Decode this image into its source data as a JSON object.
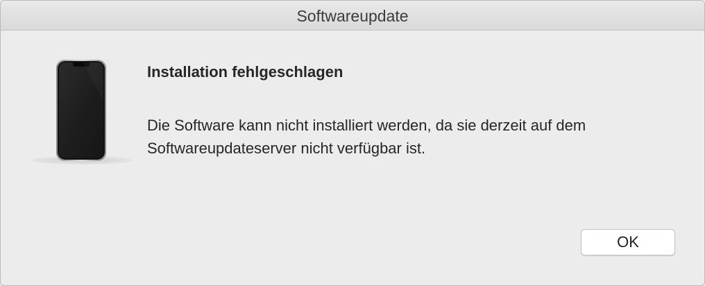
{
  "window": {
    "title": "Softwareupdate"
  },
  "alert": {
    "icon": "iphone-device-icon",
    "heading": "Installation fehlgeschlagen",
    "message": "Die Software kann nicht installiert werden, da sie derzeit auf dem Softwareupdateserver nicht verfügbar ist."
  },
  "buttons": {
    "ok_label": "OK"
  },
  "colors": {
    "window_background": "#ececec",
    "titlebar_background": "#dedede",
    "text": "#262626",
    "device_screen": "#1e1e1e"
  }
}
